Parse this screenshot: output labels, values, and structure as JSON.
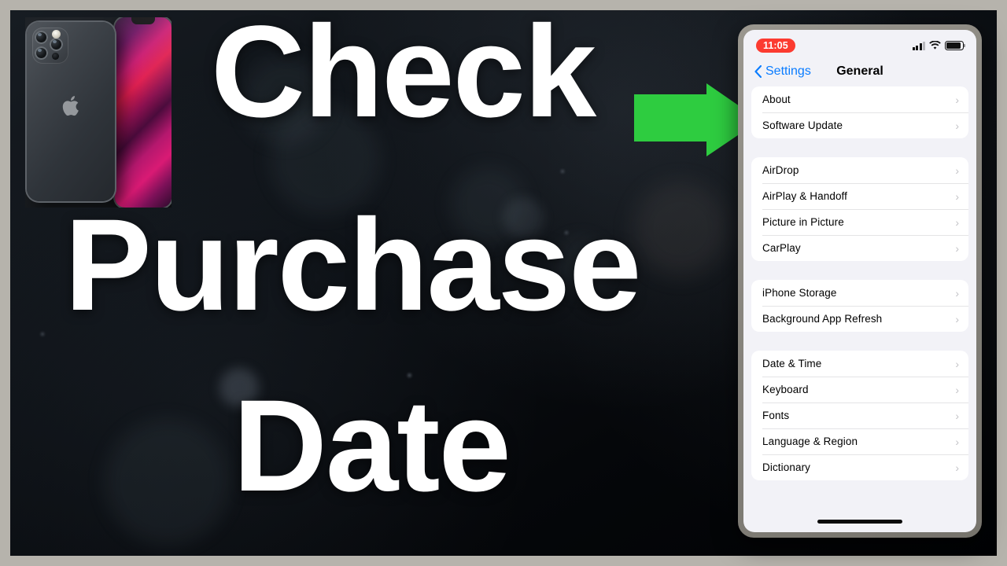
{
  "thumbnail": {
    "border_color": "#b6b3ac",
    "background_color": "#0d1116",
    "headline": {
      "line1": "Check",
      "line2": "Purchase",
      "line3": "Date",
      "color": "#ffffff"
    },
    "arrow": {
      "name": "green-right-arrow",
      "color": "#2ecc40",
      "direction": "right",
      "points_to": "About"
    },
    "product_photo": {
      "name": "iphone-13-pro-graphite-photo",
      "alt": "iPhone 13 Pro graphite back and front"
    }
  },
  "phone": {
    "status_bar": {
      "time": "11:05",
      "time_badge_color": "#fc3b30",
      "icons": [
        "cellular-signal-icon",
        "wifi-icon",
        "battery-icon"
      ]
    },
    "nav": {
      "back_label": "Settings",
      "back_icon": "chevron-left-icon",
      "back_color": "#0a7cff",
      "title": "General"
    },
    "groups": [
      {
        "rows": [
          {
            "label": "About",
            "accessory": "chevron-right-icon"
          },
          {
            "label": "Software Update",
            "accessory": "chevron-right-icon"
          }
        ]
      },
      {
        "rows": [
          {
            "label": "AirDrop",
            "accessory": "chevron-right-icon"
          },
          {
            "label": "AirPlay & Handoff",
            "accessory": "chevron-right-icon"
          },
          {
            "label": "Picture in Picture",
            "accessory": "chevron-right-icon"
          },
          {
            "label": "CarPlay",
            "accessory": "chevron-right-icon"
          }
        ]
      },
      {
        "rows": [
          {
            "label": "iPhone Storage",
            "accessory": "chevron-right-icon"
          },
          {
            "label": "Background App Refresh",
            "accessory": "chevron-right-icon"
          }
        ]
      },
      {
        "rows": [
          {
            "label": "Date & Time",
            "accessory": "chevron-right-icon"
          },
          {
            "label": "Keyboard",
            "accessory": "chevron-right-icon"
          },
          {
            "label": "Fonts",
            "accessory": "chevron-right-icon"
          },
          {
            "label": "Language & Region",
            "accessory": "chevron-right-icon"
          },
          {
            "label": "Dictionary",
            "accessory": "chevron-right-icon"
          }
        ]
      }
    ],
    "home_indicator": true
  }
}
